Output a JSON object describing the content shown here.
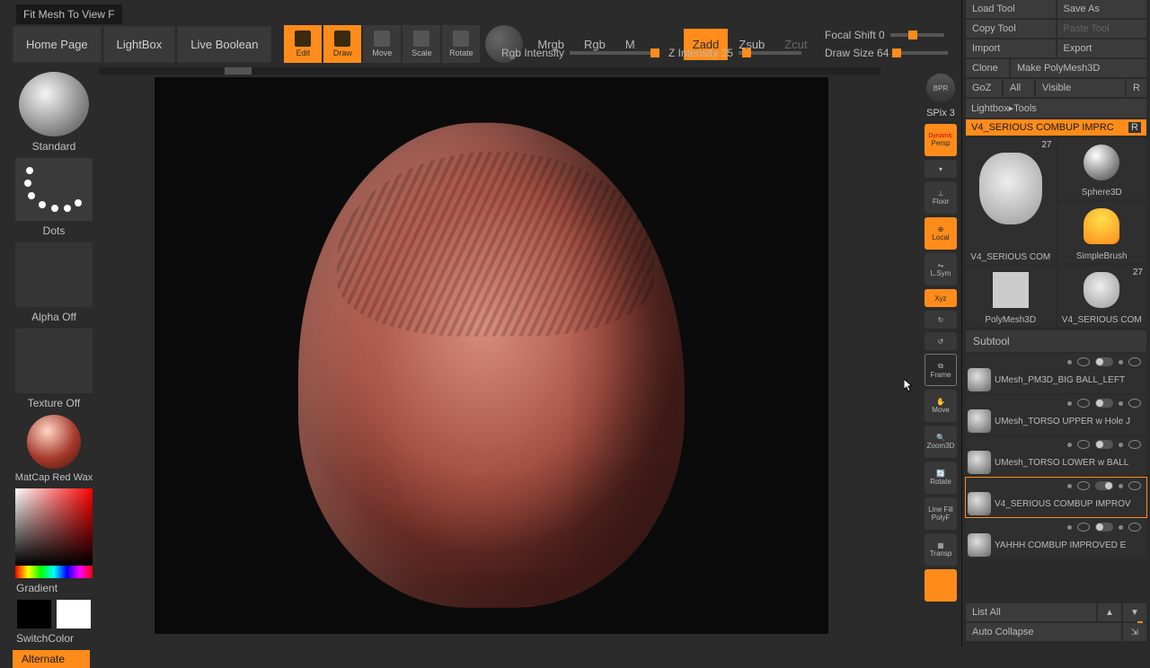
{
  "tooltip": "Fit Mesh To View F",
  "top": {
    "home": "Home Page",
    "lightbox": "LightBox",
    "liveboolean": "Live Boolean",
    "edit": "Edit",
    "draw": "Draw",
    "move": "Move",
    "scale": "Scale",
    "rotate": "Rotate",
    "mrgb": "Mrgb",
    "rgb": "Rgb",
    "m": "M",
    "zadd": "Zadd",
    "zsub": "Zsub",
    "zcut": "Zcut",
    "rgbIntensity": "Rgb Intensity",
    "focalShift": "Focal Shift 0",
    "zIntensity": "Z Intensity 25",
    "drawSize": "Draw Size 64"
  },
  "left": {
    "brush": "Standard",
    "stroke": "Dots",
    "alpha": "Alpha Off",
    "texture": "Texture Off",
    "material": "MatCap Red Wax",
    "gradient": "Gradient",
    "switchcolor": "SwitchColor",
    "alternate": "Alternate"
  },
  "rightStrip": {
    "bpr": "BPR",
    "spix": "SPix 3",
    "persp": "Persp",
    "floor": "Floor",
    "local": "Local",
    "lsym": "L.Sym",
    "xyz": "Xyz",
    "frame": "Frame",
    "move": "Move",
    "zoom3d": "Zoom3D",
    "rotate": "Rotate",
    "linefill": "Line Fill",
    "polyf": "PolyF",
    "transp": "Transp"
  },
  "toolPanel": {
    "loadTool": "Load Tool",
    "saveAs": "Save As",
    "copyTool": "Copy Tool",
    "pasteTool": "Paste Tool",
    "import": "Import",
    "export": "Export",
    "clone": "Clone",
    "makePolymesh": "Make PolyMesh3D",
    "goz": "GoZ",
    "all": "All",
    "visible": "Visible",
    "r": "R",
    "lightboxTools": "Lightbox▸Tools",
    "activeTool": "V4_SERIOUS COMBUP IMPRC",
    "rBadge": "R",
    "tools": [
      {
        "label": "V4_SERIOUS COM",
        "count": "27",
        "kind": "head"
      },
      {
        "label": "Sphere3D",
        "count": "",
        "kind": "sphere"
      },
      {
        "label": "SimpleBrush",
        "count": "",
        "kind": "sbrush"
      },
      {
        "label": "PolyMesh3D",
        "count": "",
        "kind": "star"
      },
      {
        "label": "V4_SERIOUS COM",
        "count": "27",
        "kind": "head"
      }
    ],
    "subtoolHeader": "Subtool",
    "subtools": [
      {
        "name": "UMesh_PM3D_BIG BALL_LEFT",
        "selected": false
      },
      {
        "name": "UMesh_TORSO UPPER w Hole J",
        "selected": false
      },
      {
        "name": "UMesh_TORSO LOWER w BALL",
        "selected": false
      },
      {
        "name": "V4_SERIOUS COMBUP IMPROV",
        "selected": true
      },
      {
        "name": "YAHHH COMBUP IMPROVED E",
        "selected": false
      }
    ],
    "listAll": "List All",
    "autoCollapse": "Auto Collapse"
  }
}
